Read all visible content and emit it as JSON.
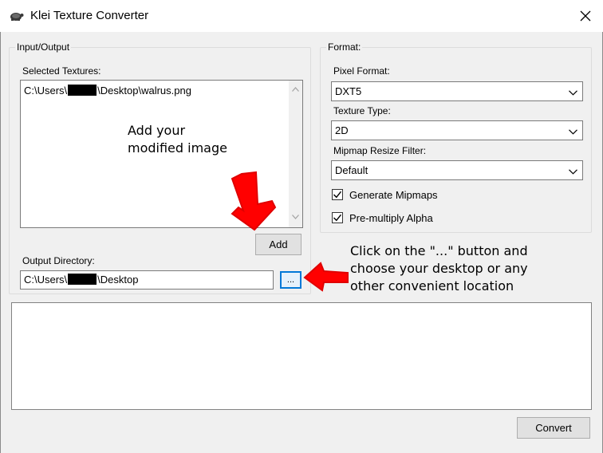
{
  "window": {
    "title": "Klei Texture Converter",
    "app_icon": "tortoise-icon",
    "close_icon": "close-icon"
  },
  "input_output": {
    "group_label": "Input/Output",
    "selected_textures_label": "Selected Textures:",
    "textures": [
      {
        "prefix": "C:\\Users\\",
        "suffix": "\\Desktop\\walrus.png"
      }
    ],
    "add_button": "Add",
    "output_directory_label": "Output Directory:",
    "output_directory": {
      "prefix": "C:\\Users\\",
      "suffix": "\\Desktop"
    },
    "browse_button": "..."
  },
  "format": {
    "group_label": "Format:",
    "pixel_format_label": "Pixel Format:",
    "pixel_format": "DXT5",
    "texture_type_label": "Texture Type:",
    "texture_type": "2D",
    "mipmap_filter_label": "Mipmap Resize Filter:",
    "mipmap_filter": "Default",
    "generate_mipmaps": {
      "label": "Generate Mipmaps",
      "checked": true
    },
    "premultiply_alpha": {
      "label": "Pre-multiply Alpha",
      "checked": true
    }
  },
  "annotations": {
    "add_image": [
      "Add your",
      "modified image"
    ],
    "browse_hint": [
      "Click on the \"...\" button and",
      "choose your desktop or any",
      "other convenient location"
    ],
    "arrow_color": "#ff0000"
  },
  "footer": {
    "convert_button": "Convert"
  }
}
